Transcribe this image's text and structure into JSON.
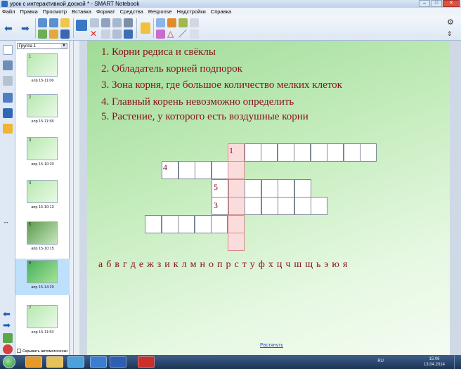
{
  "window": {
    "title": "урок с интерактивной доской * - SMART Notebook"
  },
  "menu": [
    "Файл",
    "Правка",
    "Просмотр",
    "Вставка",
    "Формат",
    "Средства",
    "Response",
    "Надстройки",
    "Справка"
  ],
  "sorter": {
    "group": "Группа 1",
    "pages": [
      {
        "num": "1",
        "time": "апр 15-11:06"
      },
      {
        "num": "2",
        "time": "апр 15-11:58"
      },
      {
        "num": "3",
        "time": "апр 15-10:20"
      },
      {
        "num": "4",
        "time": "апр 15-10:13"
      },
      {
        "num": "5",
        "time": "апр 15-10:15"
      },
      {
        "num": "6",
        "time": "апр 15-14:29"
      },
      {
        "num": "7",
        "time": "апр 15-11:53"
      }
    ],
    "autohide": "Скрывать автоматически"
  },
  "page": {
    "clues": [
      "1. Корни редиса и свёклы",
      "2. Обладатель корней подпорок",
      "3. Зона корня, где большое количество мелких клеток",
      "4. Главный корень невозможно определить",
      "5. Растение, у которого есть воздушные корни"
    ],
    "crossword_numbers": {
      "n1": "1",
      "n4": "4",
      "n5": "5",
      "n3": "3"
    },
    "alphabet": [
      "а",
      "б",
      "в",
      "г",
      "д",
      "е",
      "ж",
      "з",
      "и",
      "к",
      "л",
      "м",
      "н",
      "о",
      "п",
      "р",
      "с",
      "т",
      "у",
      "ф",
      "х",
      "ц",
      "ч",
      "ш",
      "щ",
      "ь",
      "э",
      "ю",
      "я"
    ],
    "stretch_link": "Растянуть"
  },
  "taskbar": {
    "lang": "RU",
    "time": "15:06",
    "date": "13.04.2014"
  },
  "colors": {
    "clue_text": "#8b1020",
    "key_column": "#fbdcdc",
    "page_green": "#9fdc96"
  }
}
